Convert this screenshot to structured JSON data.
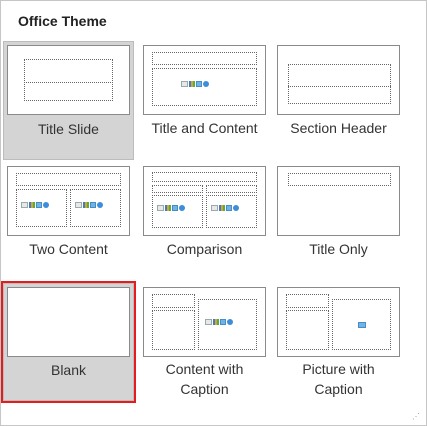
{
  "gallery": {
    "title": "Office Theme",
    "layouts": [
      {
        "label": "Title Slide"
      },
      {
        "label": "Title and Content"
      },
      {
        "label": "Section Header"
      },
      {
        "label": "Two Content"
      },
      {
        "label": "Comparison"
      },
      {
        "label": "Title Only"
      },
      {
        "label": "Blank"
      },
      {
        "label_line1": "Content with",
        "label_line2": "Caption"
      },
      {
        "label_line1": "Picture with",
        "label_line2": "Caption"
      }
    ]
  }
}
